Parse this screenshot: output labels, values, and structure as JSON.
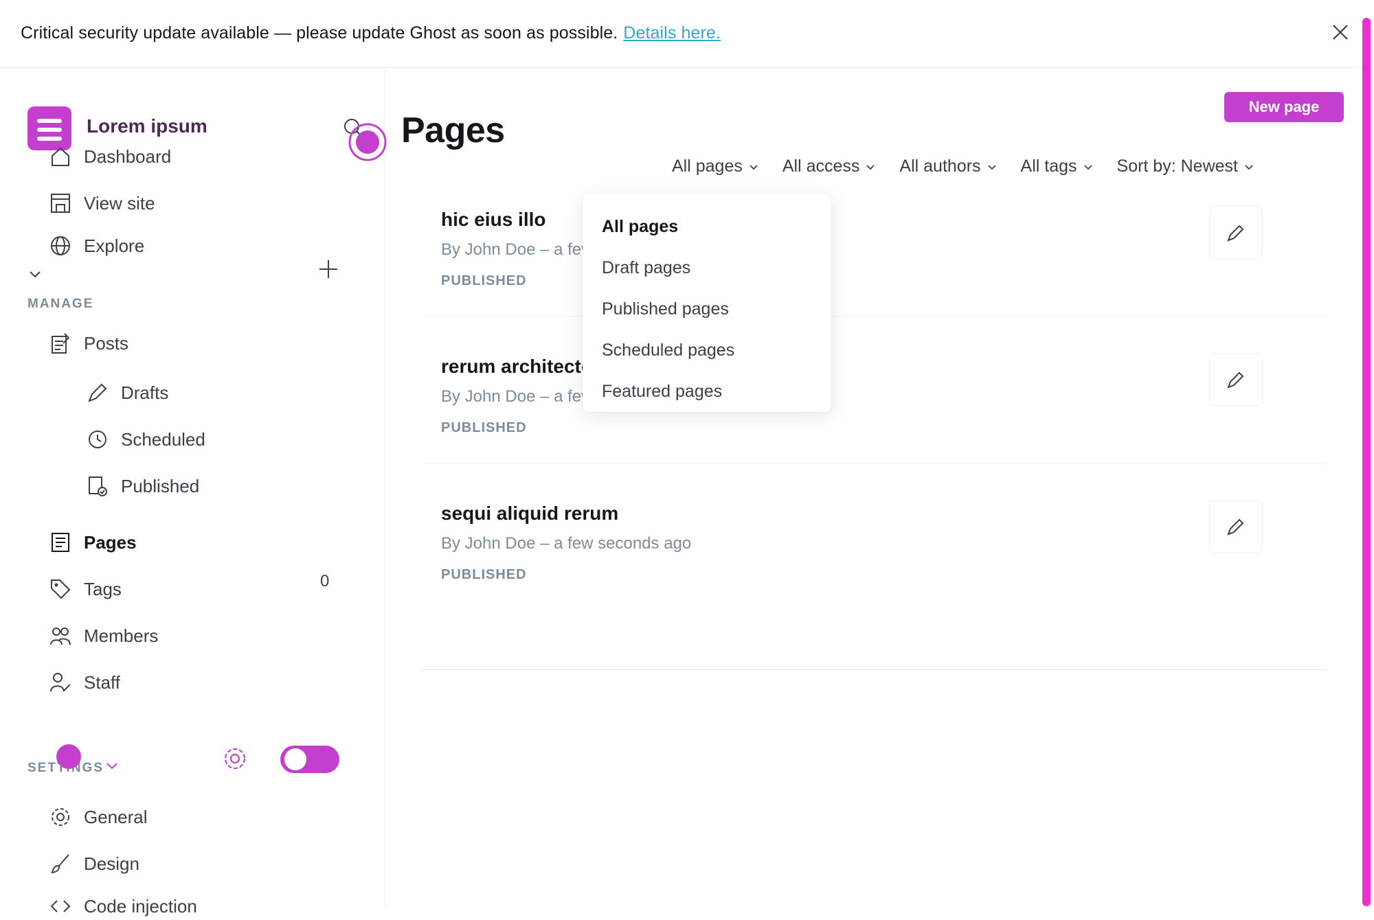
{
  "banner": {
    "message": "Critical security update available — please update Ghost as soon as possible.",
    "link": "Details here."
  },
  "sidebar": {
    "site_name": "Lorem ipsum",
    "items": {
      "dashboard": "Dashboard",
      "view_site": "View site",
      "explore": "Explore",
      "posts": "Posts",
      "drafts": "Drafts",
      "scheduled": "Scheduled",
      "published": "Published",
      "pages": "Pages",
      "tags": "Tags",
      "members": "Members",
      "staff": "Staff",
      "general": "General",
      "design": "Design",
      "code_injection": "Code injection"
    },
    "members_count": "0",
    "sections": {
      "manage": "MANAGE",
      "settings": "SETTINGS"
    }
  },
  "main": {
    "title": "Pages",
    "new_button": "New page",
    "filters": {
      "type": "All pages",
      "access": "All access",
      "authors": "All authors",
      "tags": "All tags",
      "sort": "Sort by: Newest"
    },
    "dropdown": {
      "options": [
        "All pages",
        "Draft pages",
        "Published pages",
        "Scheduled pages",
        "Featured pages"
      ],
      "selected": "All pages"
    },
    "rows": [
      {
        "title": "hic eius illo",
        "meta": "By John Doe – a few seconds ago",
        "status": "PUBLISHED"
      },
      {
        "title": "rerum architecto quibusdam",
        "meta": "By John Doe – a few seconds ago",
        "status": "PUBLISHED"
      },
      {
        "title": "sequi aliquid rerum",
        "meta": "By John Doe – a few seconds ago",
        "status": "PUBLISHED"
      }
    ]
  },
  "colors": {
    "accent": "#c43fcd",
    "link": "#30a7c9",
    "muted": "#7c8b9a",
    "text": "#15171a"
  }
}
